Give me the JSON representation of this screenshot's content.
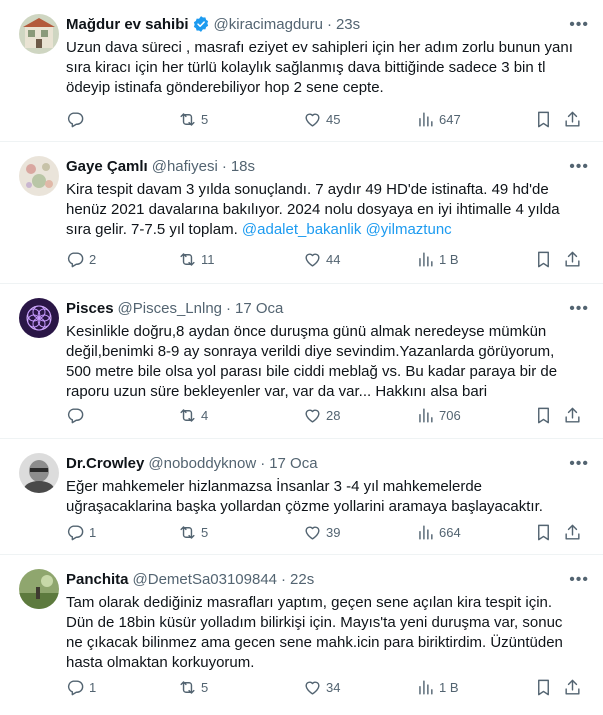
{
  "tweets": [
    {
      "name": "Mağdur ev sahibi",
      "verified": true,
      "handle": "@kiracimagduru",
      "time": "23s",
      "lines": [
        "Uzun dava süreci , masrafı eziyet ev sahipleri için her adım zorlu bunun yanı",
        "sıra kiracı için her türlü kolaylık sağlanmış dava bittiğinde sadece 3 bin tl",
        "ödeyip istinafa gönderebiliyor hop 2 sene cepte."
      ],
      "replies": "",
      "retweets": "5",
      "likes": "45",
      "views": "647"
    },
    {
      "name": "Gaye Çamlı",
      "verified": false,
      "handle": "@hafiyesi",
      "time": "18s",
      "lines": [
        "Kira tespit davam 3 yılda sonuçlandı. 7 aydır 49 HD'de istinafta. 49 hd'de",
        "henüz 2021 davalarına bakılıyor. 2024 nolu dosyaya en iyi ihtimalle 4 yılda",
        "sıra gelir. 7-7.5 yıl toplam."
      ],
      "mentions": [
        "@adalet_bakanlik",
        "@yilmaztunc"
      ],
      "replies": "2",
      "retweets": "11",
      "likes": "44",
      "views": "1 B"
    },
    {
      "name": "Pisces",
      "verified": false,
      "handle": "@Pisces_Lnlng",
      "time": "17 Oca",
      "lines": [
        "Kesinlikle doğru,8 aydan önce duruşma günü almak neredeyse mümkün",
        "değil,benimki 8-9 ay sonraya verildi diye sevindim.Yazanlarda görüyorum,",
        "500 metre bile olsa yol parası bile ciddi meblağ vs. Bu kadar paraya bir de",
        "raporu uzun süre bekleyenler var, var da var... Hakkını alsa bari"
      ],
      "replies": "",
      "retweets": "4",
      "likes": "28",
      "views": "706"
    },
    {
      "name": "Dr.Crowley",
      "verified": false,
      "handle": "@noboddyknow",
      "time": "17 Oca",
      "lines": [
        "Eğer mahkemeler hizlanmazsa İnsanlar 3 -4 yıl mahkemelerde",
        "uğraşacaklarina başka yollardan çözme yollarini aramaya başlayacaktır."
      ],
      "replies": "1",
      "retweets": "5",
      "likes": "39",
      "views": "664"
    },
    {
      "name": "Panchita",
      "verified": false,
      "handle": "@DemetSa03109844",
      "time": "22s",
      "lines": [
        "Tam olarak dediğiniz masrafları yaptım, geçen sene açılan kira tespit için.",
        "Dün de 18bin küsür yolladım bilirkişi için. Mayıs'ta yeni duruşma var, sonuc",
        "ne çıkacak bilinmez ama gecen sene mahk.icin para biriktirdim. Üzüntüden",
        "hasta olmaktan korkuyorum."
      ],
      "replies": "1",
      "retweets": "5",
      "likes": "34",
      "views": "1 B"
    }
  ],
  "more_icon": "more-dots-icon",
  "colors": {
    "text": "#0f1419",
    "secondary": "#536471",
    "link": "#1d9bf0",
    "verified": "#1d9bf0"
  }
}
